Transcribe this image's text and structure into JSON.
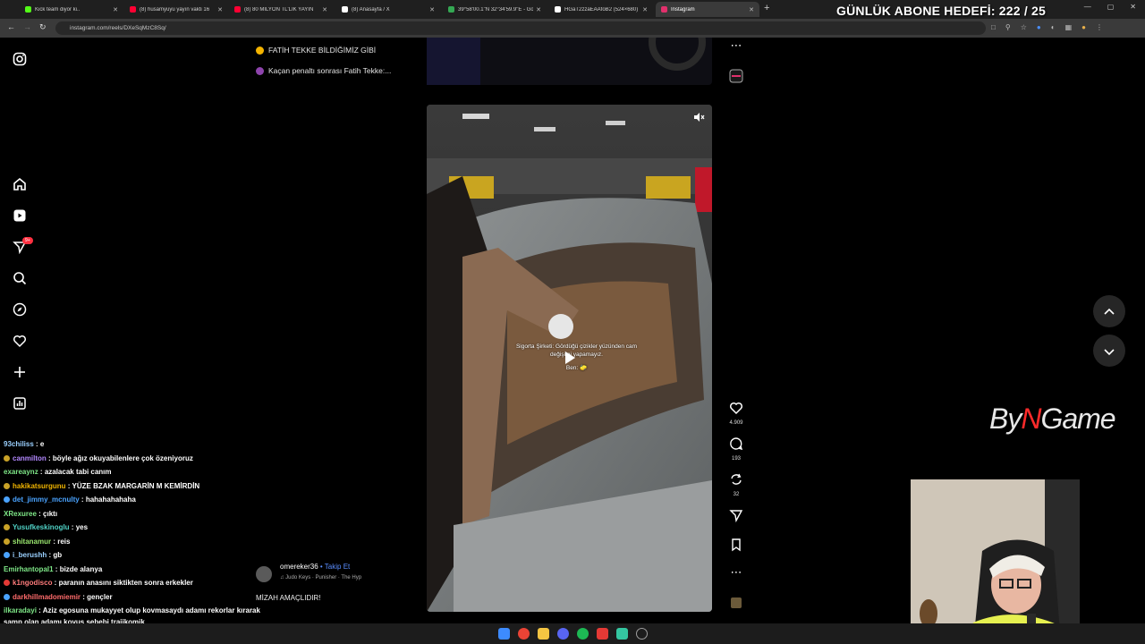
{
  "browser": {
    "tabs": [
      {
        "title": "Kick team diyor ki..",
        "icon": "kick-icon",
        "color": "#53fc18"
      },
      {
        "title": "(8) husamyuyu yayın vakti 16",
        "icon": "youtube-icon",
        "color": "#ff0033"
      },
      {
        "title": "(8) 80 MİLYON TL'LİK YAYIN",
        "icon": "youtube-icon",
        "color": "#ff0033"
      },
      {
        "title": "(8) Anasayfa / X",
        "icon": "x-icon",
        "color": "#ffffff"
      },
      {
        "title": "39°58'00.1\"N 32°34'59.9\"E - Go",
        "icon": "maps-icon",
        "color": "#34a853"
      },
      {
        "title": "HGaT2zzaEAAfoB2 (524×680)",
        "icon": "x-icon",
        "color": "#ffffff"
      },
      {
        "title": "Instagram",
        "icon": "instagram-icon",
        "color": "#e1306c"
      }
    ],
    "close_glyph": "✕",
    "new_tab_glyph": "+",
    "window_controls": [
      "—",
      "▢",
      "✕"
    ],
    "url": "instagram.com/reels/DXeSqMzC8Sq/"
  },
  "overlay": {
    "subscriber_goal": "GÜNLÜK ABONE HEDEFİ: 222 / 25",
    "brand_prefix": "By",
    "brand_mark": "N",
    "brand_suffix": "Game"
  },
  "notifications": [
    {
      "text": "FATİH TEKKE BİLDİĞİMİZ GİBİ",
      "color": "#f4b400"
    },
    {
      "text": "Kaçan penaltı sonrası Fatih Tekke:...",
      "color": "#8e44ad"
    }
  ],
  "sidebar": {
    "badge": "9+"
  },
  "reel": {
    "overlay_caption_1": "Sigorta Şirketi: Gördüğü çizikler yüzünden cam",
    "overlay_caption_2": "değişimi yapamayız.",
    "overlay_caption_3": "Ben: 🧽",
    "author": "omereker36",
    "separator": " • ",
    "follow": "Takip Et",
    "audio": "Judo Keys · Punisher · The Hyp",
    "caption": "MİZAH AMAÇLIDIR!",
    "likes": "4.909",
    "comments": "193",
    "reposts": "32"
  },
  "chat": [
    {
      "user": "93chiliss",
      "text": "e",
      "color": "#9ad0ff"
    },
    {
      "user": "canmilton",
      "text": "böyle ağız okuyabilenlere çok özeniyoruz",
      "color": "#b388ff"
    },
    {
      "user": "exareaynz",
      "text": "azalacak tabi canım",
      "color": "#7ee787"
    },
    {
      "user": "hakikatsurgunu",
      "text": "YÜZE BZAK MARGARİN M KEMİRDİN",
      "color": "#f0b400"
    },
    {
      "user": "det_jimmy_mcnulty",
      "text": "hahahahahaha",
      "color": "#4aa3ff"
    },
    {
      "user": "XRexuree",
      "text": "çıktı",
      "color": "#7ee787"
    },
    {
      "user": "Yusufkeskinoglu",
      "text": "yes",
      "color": "#4fd1c5"
    },
    {
      "user": "shitanamur",
      "text": "reis",
      "color": "#9ae66e"
    },
    {
      "user": "i_berushh",
      "text": "gb",
      "color": "#9ad0ff"
    },
    {
      "user": "Emirhantopal1",
      "text": "bizde alanya",
      "color": "#7ee787"
    },
    {
      "user": "k1ngodisco",
      "text": "paranın anasını siktikten sonra erkekler",
      "color": "#ff7b7b"
    },
    {
      "user": "darkhillmadomiemir",
      "text": "gençler",
      "color": "#ff6b6b"
    },
    {
      "user": "ilkaradayi",
      "text": "Aziz egosuna mukayyet olup kovmasaydı adamı rekorlar kırarak",
      "color": "#7ee787"
    },
    {
      "user": "",
      "text": "samp olan adamı kovuş sebebi trajikomik",
      "color": "#ffffff"
    }
  ],
  "taskbar_icons": [
    {
      "name": "windows-start-icon",
      "color": "#3d8bff"
    },
    {
      "name": "chrome-icon",
      "color": "#ea4335"
    },
    {
      "name": "file-explorer-icon",
      "color": "#f4c542"
    },
    {
      "name": "discord-icon",
      "color": "#5865f2"
    },
    {
      "name": "spotify-icon",
      "color": "#1db954"
    },
    {
      "name": "xsplit-icon",
      "color": "#e53935"
    },
    {
      "name": "app-icon",
      "color": "#34c6a0"
    },
    {
      "name": "search-app-icon",
      "color": "#9e9e9e"
    }
  ]
}
